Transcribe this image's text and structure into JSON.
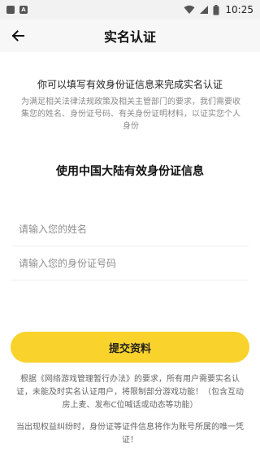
{
  "status_bar": {
    "time": "10:25",
    "left_icons": [
      "notification-icon",
      "app-icon-a"
    ],
    "left_icon_letters": [
      "",
      "A"
    ],
    "right_icons": [
      "wifi-icon",
      "cellular-signal-icon",
      "battery-icon"
    ]
  },
  "app_bar": {
    "title": "实名认证",
    "back_icon": "arrow-left-icon"
  },
  "intro": {
    "title": "你可以填写有效身份证信息来完成实名认证",
    "description": "为满足相关法律法规政策及相关主管部门的要求，我们需要收集您的姓名、身份证号码、有关身份证明材料，以证实您个人身份"
  },
  "form": {
    "section_title": "使用中国大陆有效身份证信息",
    "name_placeholder": "请输入您的姓名",
    "name_value": "",
    "id_placeholder": "请输入您的身份证号码",
    "id_value": ""
  },
  "submit": {
    "label": "提交资料"
  },
  "notice": {
    "text": "根据《网络游戏管理暂行办法》的要求，所有用户需要实名认证，未能及时实名认证用户，将限制部分游戏功能！（包含互动房上麦、发布C位喊话或动态等功能）",
    "dispute": "当出现权益纠纷时，身份证等证件信息将作为账号所属的唯一凭证！"
  },
  "colors": {
    "accent": "#f9d22c",
    "status_bar_bg": "#f2f2f2",
    "app_bar_bg": "#f7f7f7",
    "muted_text": "#8a8a8a"
  }
}
